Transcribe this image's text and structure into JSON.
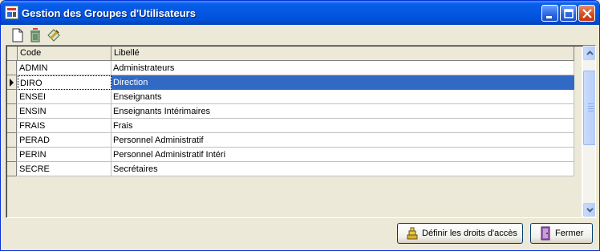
{
  "window": {
    "title": "Gestion des Groupes d'Utilisateurs",
    "title_color": "#FFFFFF",
    "titlebar_color": "#0256E0"
  },
  "toolbar": {
    "icons": [
      "new-document-icon",
      "delete-recycle-icon",
      "edit-rights-icon"
    ]
  },
  "table": {
    "columns": [
      "Code",
      "Libellé"
    ],
    "selected_row_index": 1,
    "selection_color": "#316AC5",
    "rows": [
      {
        "code": "ADMIN",
        "libelle": "Administrateurs"
      },
      {
        "code": "DIRO",
        "libelle": "Direction"
      },
      {
        "code": "ENSEI",
        "libelle": "Enseignants"
      },
      {
        "code": "ENSIN",
        "libelle": "Enseignants Intérimaires"
      },
      {
        "code": "FRAIS",
        "libelle": "Frais"
      },
      {
        "code": "PERAD",
        "libelle": "Personnel Administratif"
      },
      {
        "code": "PERIN",
        "libelle": "Personnel Administratif Intéri"
      },
      {
        "code": "SECRE",
        "libelle": "Secrétaires"
      }
    ]
  },
  "buttons": {
    "define_rights": "Définir les droits d'accès",
    "close": "Fermer"
  }
}
